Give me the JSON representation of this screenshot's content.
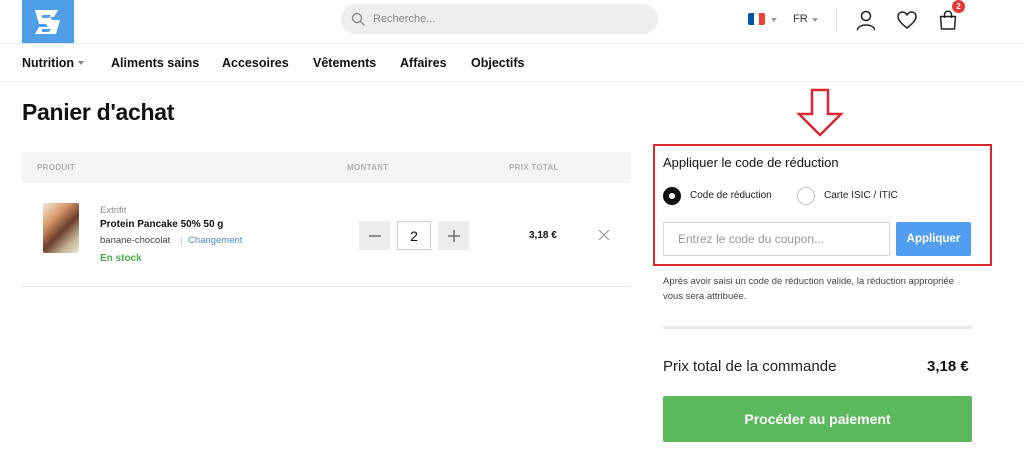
{
  "header": {
    "search": {
      "placeholder": "Recherche..."
    },
    "language": "FR",
    "cart_count": "2",
    "flag_colors": [
      "#0055a4",
      "#ffffff",
      "#ef4135"
    ]
  },
  "nav": {
    "items": [
      {
        "label": "Nutrition",
        "has_dropdown": true
      },
      {
        "label": "Aliments sains"
      },
      {
        "label": "Accesoires"
      },
      {
        "label": "Vêtements"
      },
      {
        "label": "Affaires"
      },
      {
        "label": "Objectifs"
      }
    ]
  },
  "page": {
    "title": "Panier d'achat"
  },
  "cart": {
    "columns": [
      "PRODUIT",
      "MONTANT",
      "PRIX TOTAL"
    ],
    "items": [
      {
        "brand": "Extrifit",
        "name": "Protein Pancake 50% 50 g",
        "variant": "banane-chocolat",
        "separator": "|",
        "change_label": "Changement",
        "stock": "En stock",
        "quantity": "2",
        "total": "3,18 €"
      }
    ]
  },
  "coupon": {
    "title": "Appliquer le code de réduction",
    "options": [
      {
        "label": "Code de réduction",
        "selected": true
      },
      {
        "label": "Carte ISIC / ITIC",
        "selected": false
      }
    ],
    "input_placeholder": "Entrez le code du coupon...",
    "apply_label": "Appliquer",
    "note": "Après avoir saisi un code de réduction valide, la réduction appropriée vous sera attribuée.",
    "highlight_color": "#d9282f"
  },
  "summary": {
    "total_label": "Prix total de la commande",
    "total_value": "3,18 €",
    "checkout_label": "Procéder au paiement"
  },
  "colors": {
    "accent_blue": "#519ef0",
    "success_green": "#5cb85c",
    "stock_green": "#4caf50",
    "badge_red": "#e53935"
  }
}
